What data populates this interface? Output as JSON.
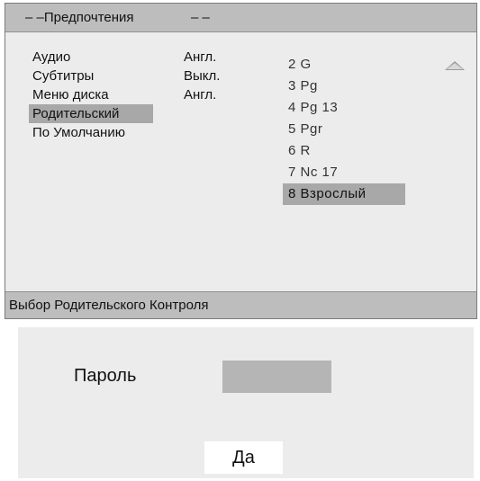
{
  "osd": {
    "title_left": "– –Предпочтения",
    "title_right": "– –",
    "menu_items": [
      "Аудио",
      "Субтитры",
      "Меню диска",
      "Родительский",
      "По Умолчанию"
    ],
    "menu_values": [
      "Англ.",
      "Выкл.",
      "Англ."
    ],
    "ratings": [
      "2 G",
      "3 Pg",
      "4 Pg 13",
      "5 Pgr",
      "6 R",
      "7 Nc 17",
      "8 Взрослый"
    ],
    "selected_menu": "Родительский",
    "selected_rating": "8 Взрослый",
    "scroll_icon": "triangle-up-icon",
    "status": "Выбор Родительского Контроля"
  },
  "password_dialog": {
    "label": "Пароль",
    "value": "",
    "ok_label": "Да"
  },
  "colors": {
    "panel_bg": "#ececec",
    "bar_bg": "#bdbdbd",
    "highlight": "#a8a8a8",
    "field": "#b5b5b5"
  }
}
